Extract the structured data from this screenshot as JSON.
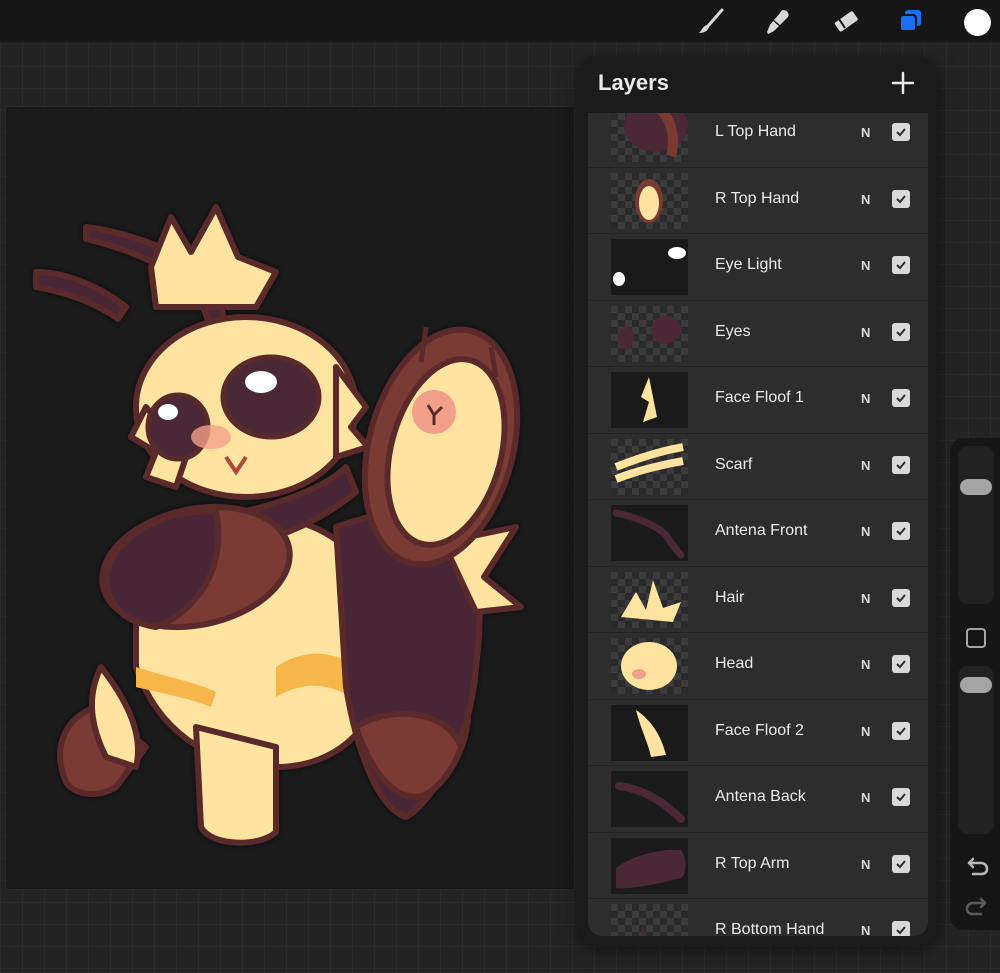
{
  "toolbar": {
    "tools": [
      {
        "name": "brush",
        "icon": "brush-icon"
      },
      {
        "name": "smudge",
        "icon": "smudge-icon"
      },
      {
        "name": "eraser",
        "icon": "eraser-icon"
      },
      {
        "name": "layers",
        "icon": "layers-icon",
        "active": true,
        "accent": "#1a6ef5"
      },
      {
        "name": "color",
        "icon": "color-swatch",
        "value": "#ffffff"
      }
    ]
  },
  "layers_panel": {
    "title": "Layers",
    "add_icon": "plus-icon",
    "layers": [
      {
        "name": "L Top Hand",
        "blend": "N",
        "visible": true,
        "thumb": "hand-l"
      },
      {
        "name": "R Top Hand",
        "blend": "N",
        "visible": true,
        "thumb": "hand-r"
      },
      {
        "name": "Eye Light",
        "blend": "N",
        "visible": true,
        "thumb": "eye-light"
      },
      {
        "name": "Eyes",
        "blend": "N",
        "visible": true,
        "thumb": "eyes"
      },
      {
        "name": "Face Floof 1",
        "blend": "N",
        "visible": true,
        "thumb": "floof1"
      },
      {
        "name": "Scarf",
        "blend": "N",
        "visible": true,
        "thumb": "scarf"
      },
      {
        "name": "Antena Front",
        "blend": "N",
        "visible": true,
        "thumb": "antena"
      },
      {
        "name": "Hair",
        "blend": "N",
        "visible": true,
        "thumb": "hair"
      },
      {
        "name": "Head",
        "blend": "N",
        "visible": true,
        "thumb": "head"
      },
      {
        "name": "Face Floof 2",
        "blend": "N",
        "visible": true,
        "thumb": "floof2"
      },
      {
        "name": "Antena Back",
        "blend": "N",
        "visible": true,
        "thumb": "antena"
      },
      {
        "name": "R Top Arm",
        "blend": "N",
        "visible": true,
        "thumb": "arm"
      },
      {
        "name": "R Bottom Hand",
        "blend": "N",
        "visible": true,
        "thumb": "hand-b"
      }
    ]
  },
  "sidebar": {
    "brush_size_level": 0.22,
    "opacity_level": 0.05,
    "undo_icon": "undo-icon",
    "redo_icon": "redo-icon"
  },
  "colors": {
    "outline": "#5a2a2a",
    "fur": "#ffe3a0",
    "fur_shade": "#f6b64a",
    "dark_purple": "#4a2836",
    "mahogany": "#7a3a34",
    "blush": "#f2a08a"
  }
}
